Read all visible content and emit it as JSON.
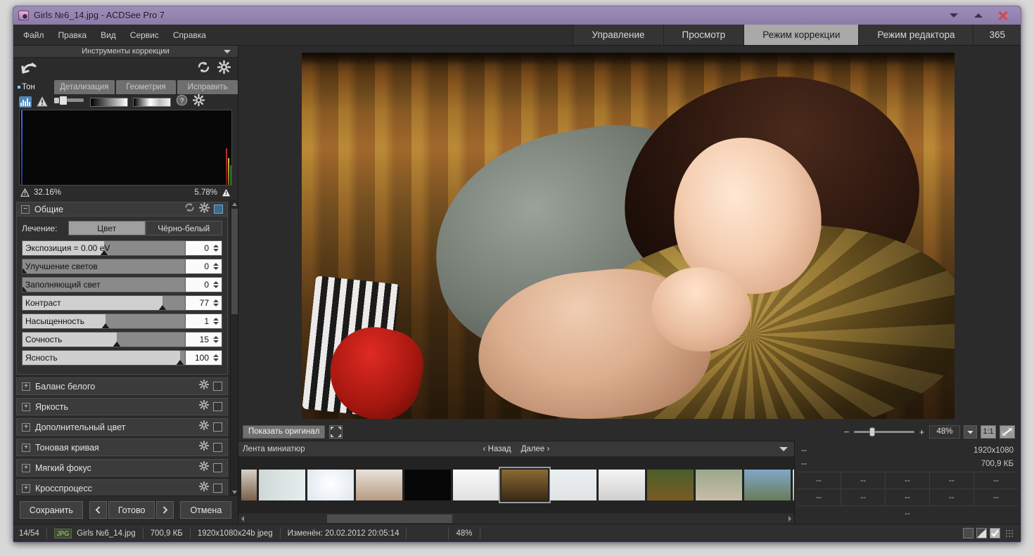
{
  "window": {
    "title": "Girls №6_14.jpg - ACDSee Pro 7",
    "app_icon": "camera-icon",
    "minimize_icon": "chevron-down-icon",
    "maximize_icon": "chevron-up-icon",
    "close_icon": "close-icon",
    "titlebar_color": "#9585b0"
  },
  "menu": {
    "items": [
      {
        "label": "Файл"
      },
      {
        "label": "Правка"
      },
      {
        "label": "Вид"
      },
      {
        "label": "Сервис"
      },
      {
        "label": "Справка"
      }
    ]
  },
  "modes": {
    "tabs": [
      {
        "label": "Управление",
        "active": false
      },
      {
        "label": "Просмотр",
        "active": false
      },
      {
        "label": "Режим коррекции",
        "active": true
      },
      {
        "label": "Режим редактора",
        "active": false
      },
      {
        "label": "365",
        "active": false
      }
    ],
    "active_color": "#a9a9a9"
  },
  "left_panel": {
    "header": "Инструменты коррекции",
    "header_caret": "chevron-down-icon",
    "toolbar": {
      "undo_icon": "undo-arrow-icon",
      "reset_icon": "refresh-icon",
      "settings_icon": "gear-icon"
    },
    "tabs": [
      {
        "label": "Тон",
        "active": true
      },
      {
        "label": "Детализация",
        "active": false
      },
      {
        "label": "Геометрия",
        "active": false
      },
      {
        "label": "Исправить",
        "active": false
      }
    ],
    "icon_row": [
      {
        "name": "histogram-icon",
        "selected": true
      },
      {
        "name": "warning-triangle-icon",
        "selected": false
      },
      {
        "name": "brush-icon",
        "selected": false
      },
      {
        "name": "gradient-bar-black-white",
        "selected": false
      },
      {
        "name": "gradient-bar-highlight",
        "selected": false
      },
      {
        "name": "help-icon",
        "selected": false
      },
      {
        "name": "gear-icon",
        "selected": false
      }
    ],
    "histogram": {
      "shadow_clip_pct": "32.16%",
      "highlight_clip_pct": "5.78%",
      "shadow_warn_icon": "warning-triangle-icon",
      "highlight_warn_icon": "warning-triangle-icon"
    },
    "general_section": {
      "title": "Общие",
      "expanded": true,
      "collapse_glyph": "−",
      "reset_icon": "refresh-icon",
      "gear_icon": "gear-icon",
      "enable_checkbox": "checkbox-checked",
      "treatment_label": "Лечение:",
      "treatment_options": [
        {
          "label": "Цвет",
          "active": true
        },
        {
          "label": "Чёрно-белый",
          "active": false
        }
      ],
      "sliders": [
        {
          "label": "Экспозиция = 0.00 eV",
          "value": "0",
          "fill_pct": 50,
          "thumb_pct": 50
        },
        {
          "label": "Улучшение светов",
          "value": "0",
          "fill_pct": 0,
          "thumb_pct": 1
        },
        {
          "label": "Заполняющий свет",
          "value": "0",
          "fill_pct": 0,
          "thumb_pct": 1
        },
        {
          "label": "Контраст",
          "value": "77",
          "fill_pct": 86,
          "thumb_pct": 86
        },
        {
          "label": "Насыщенность",
          "value": "1",
          "fill_pct": 51,
          "thumb_pct": 51
        },
        {
          "label": "Сочность",
          "value": "15",
          "fill_pct": 58,
          "thumb_pct": 58
        },
        {
          "label": "Ясность",
          "value": "100",
          "fill_pct": 97,
          "thumb_pct": 97
        }
      ]
    },
    "collapsed_sections": [
      {
        "label": "Баланс белого",
        "expand_glyph": "+",
        "gear_icon": "gear-icon",
        "checkbox": "checkbox-unchecked"
      },
      {
        "label": "Яркость",
        "expand_glyph": "+",
        "gear_icon": "gear-icon",
        "checkbox": "checkbox-unchecked"
      },
      {
        "label": "Дополнительный цвет",
        "expand_glyph": "+",
        "gear_icon": "gear-icon",
        "checkbox": "checkbox-unchecked"
      },
      {
        "label": "Тоновая кривая",
        "expand_glyph": "+",
        "gear_icon": "gear-icon",
        "checkbox": "checkbox-unchecked"
      },
      {
        "label": "Мягкий фокус",
        "expand_glyph": "+",
        "gear_icon": "gear-icon",
        "checkbox": "checkbox-unchecked"
      },
      {
        "label": "Кросспроцесс",
        "expand_glyph": "+",
        "gear_icon": "gear-icon",
        "checkbox": "checkbox-unchecked"
      }
    ],
    "footer": {
      "save": "Сохранить",
      "prev_icon": "chevron-left-icon",
      "done": "Готово",
      "next_icon": "chevron-right-icon",
      "cancel": "Отмена"
    }
  },
  "viewer": {
    "show_original": "Показать оригинал",
    "fit_icon": "fit-to-screen-icon",
    "zoom_out_label": "−",
    "zoom_in_label": "+",
    "zoom_value": "48%",
    "zoom_dropdown_icon": "chevron-down-icon",
    "one_to_one": "1:1",
    "fit_diag_icon": "resize-diagonal-icon"
  },
  "filmstrip": {
    "title": "Лента миниатюр",
    "prev_label": "‹ Назад",
    "next_label": "Далее ›",
    "collapse_icon": "chevron-down-icon",
    "scroll_left_icon": "arrow-left-icon",
    "scroll_right_icon": "arrow-right-icon",
    "selected_index": 6,
    "thumbs": [
      {
        "bg": "dark-portrait"
      },
      {
        "bg": "light-portrait"
      },
      {
        "bg": "white-portrait"
      },
      {
        "bg": "bed-portrait"
      },
      {
        "bg": "black-portrait"
      },
      {
        "bg": "white-red-portrait"
      },
      {
        "bg": "couch-portrait-current"
      },
      {
        "bg": "light-grey-portrait"
      },
      {
        "bg": "bw-portrait"
      },
      {
        "bg": "green-grass-portrait"
      },
      {
        "bg": "outdoor-portrait"
      },
      {
        "bg": "blue-outdoor-portrait"
      },
      {
        "bg": "pale-portrait"
      }
    ]
  },
  "metadata": {
    "line1_left": "--",
    "line1_right": "1920x1080",
    "line2_left": "--",
    "line2_right": "700,9 КБ",
    "row1": [
      "--",
      "--",
      "--",
      "--",
      "--"
    ],
    "row2": [
      "--",
      "--",
      "--",
      "--",
      "--"
    ],
    "footer": "--"
  },
  "statusbar": {
    "counter": "14/54",
    "format_badge": "JPG",
    "filename": "Girls №6_14.jpg",
    "filesize": "700,9 КБ",
    "dimensions": "1920x1080x24b jpeg",
    "modified": "Изменён: 20.02.2012 20:05:14",
    "zoom": "48%",
    "view_buttons": [
      {
        "name": "view-single-icon"
      },
      {
        "name": "view-split-icon"
      },
      {
        "name": "view-check-icon"
      }
    ],
    "resize_grip": "resize-grip-icon"
  }
}
